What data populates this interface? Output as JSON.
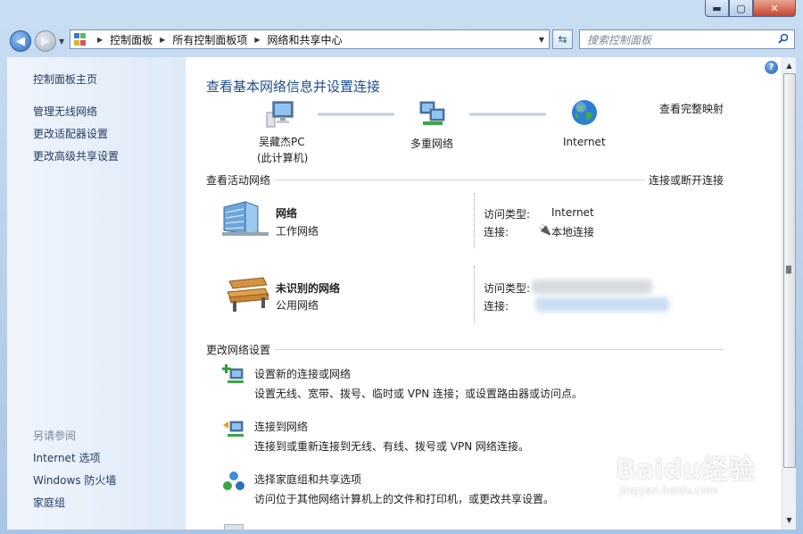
{
  "window": {
    "controls": {
      "minimize": "▬",
      "maximize": "▢",
      "close": "✕"
    }
  },
  "nav": {
    "back_icon": "back-arrow-icon",
    "forward_icon": "forward-arrow-icon",
    "breadcrumb": [
      "控制面板",
      "所有控制面板项",
      "网络和共享中心"
    ],
    "search_placeholder": "搜索控制面板"
  },
  "sidebar": {
    "home": "控制面板主页",
    "tasks": [
      "管理无线网络",
      "更改适配器设置",
      "更改高级共享设置"
    ],
    "see_also_title": "另请参阅",
    "see_also": [
      "Internet 选项",
      "Windows 防火墙",
      "家庭组"
    ]
  },
  "main": {
    "title": "查看基本网络信息并设置连接",
    "view_full_map": "查看完整映射",
    "map": {
      "computer": {
        "name": "吴藏杰PC",
        "sub": "(此计算机)"
      },
      "network": "多重网络",
      "internet": "Internet"
    },
    "active_header": "查看活动网络",
    "connect_disconnect": "连接或断开连接",
    "networks": [
      {
        "name": "网络",
        "type": "工作网络",
        "access_label": "访问类型:",
        "access_value": "Internet",
        "conn_label": "连接:",
        "conn_value": "本地连接"
      },
      {
        "name": "未识别的网络",
        "type": "公用网络",
        "access_label": "访问类型:",
        "conn_label": "连接:"
      }
    ],
    "change_header": "更改网络设置",
    "tasks": [
      {
        "title": "设置新的连接或网络",
        "desc": "设置无线、宽带、拨号、临时或 VPN 连接；或设置路由器或访问点。"
      },
      {
        "title": "连接到网络",
        "desc": "连接到或重新连接到无线、有线、拨号或 VPN 网络连接。"
      },
      {
        "title": "选择家庭组和共享选项",
        "desc": "访问位于其他网络计算机上的文件和打印机，或更改共享设置。"
      }
    ]
  },
  "watermark": {
    "brand": "Baidu经验",
    "url": "jingyan.baidu.com"
  }
}
